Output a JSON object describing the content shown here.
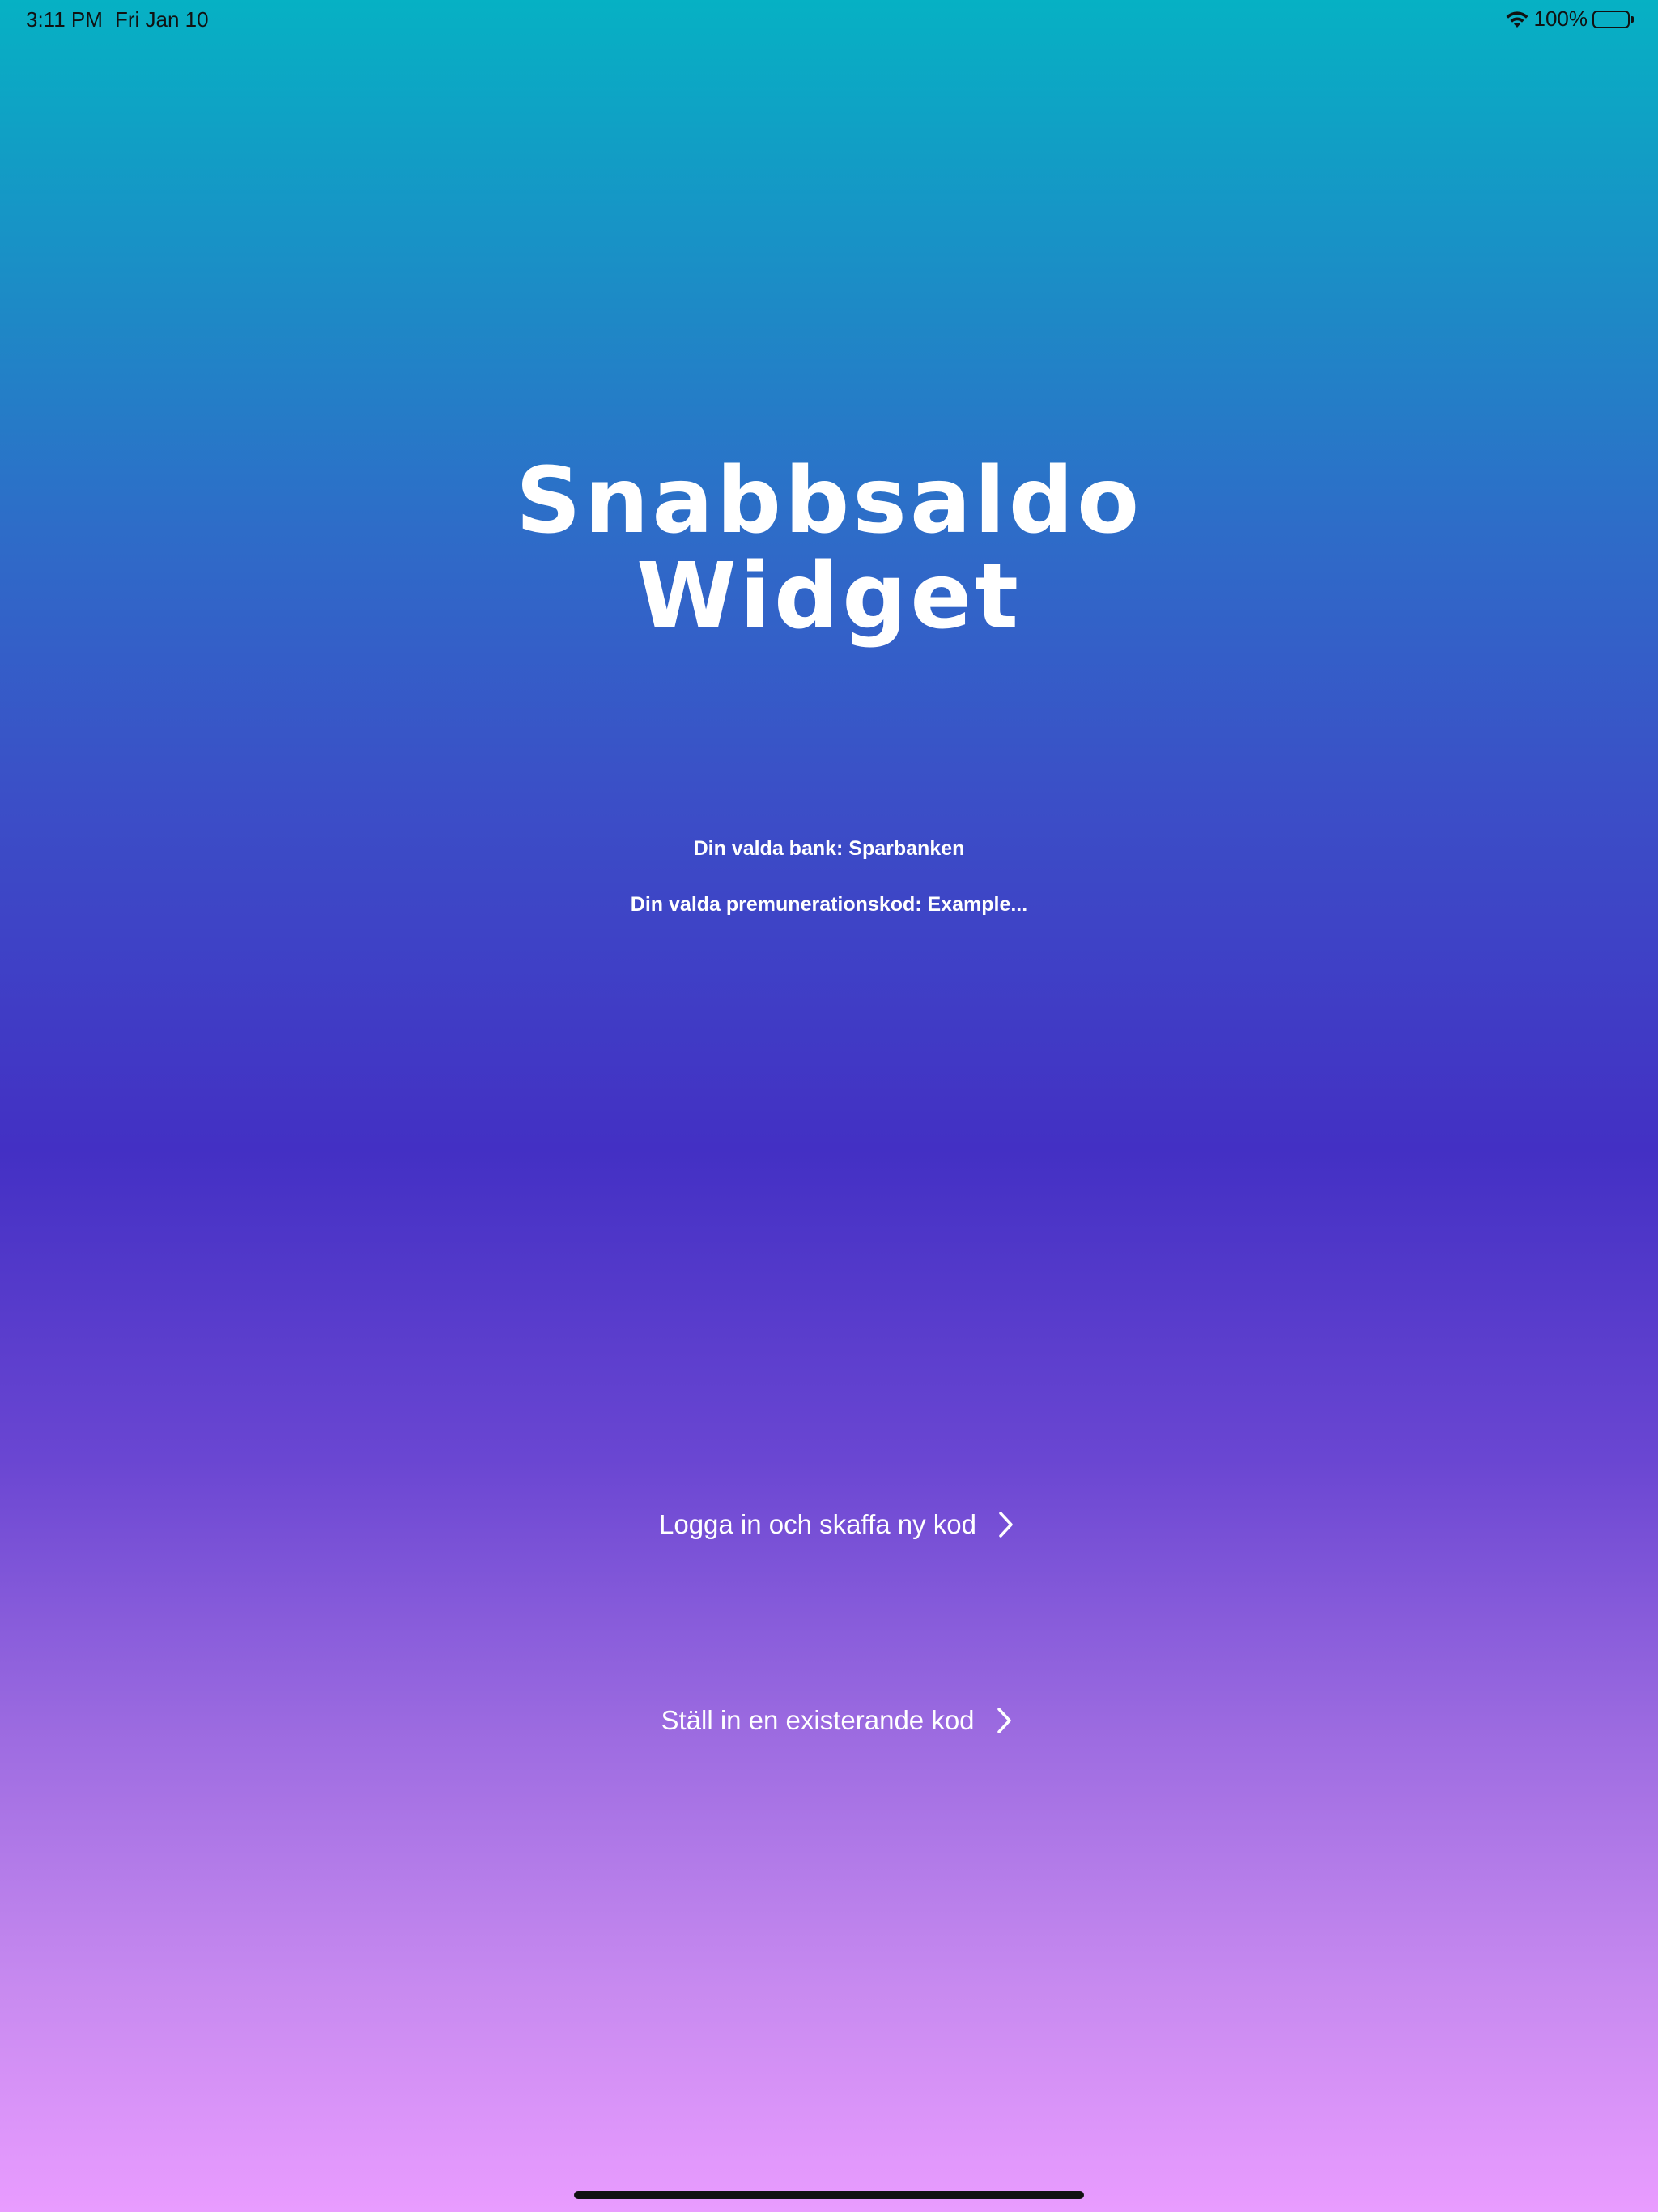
{
  "status_bar": {
    "time": "3:11 PM",
    "date": "Fri Jan 10",
    "battery": "100%",
    "battery_level": 1.0
  },
  "title": {
    "line1": "Snabbsaldo",
    "line2": "Widget"
  },
  "info": {
    "bank": "Din valda bank: Sparbanken",
    "code": "Din valda premunerationskod: Example..."
  },
  "actions": {
    "login": "Logga in och skaffa ny kod",
    "existing": "Ställ in en existerande kod"
  },
  "icons": {
    "wifi": "wifi-icon",
    "battery": "battery-icon",
    "chevron": "chevron-right-icon"
  }
}
